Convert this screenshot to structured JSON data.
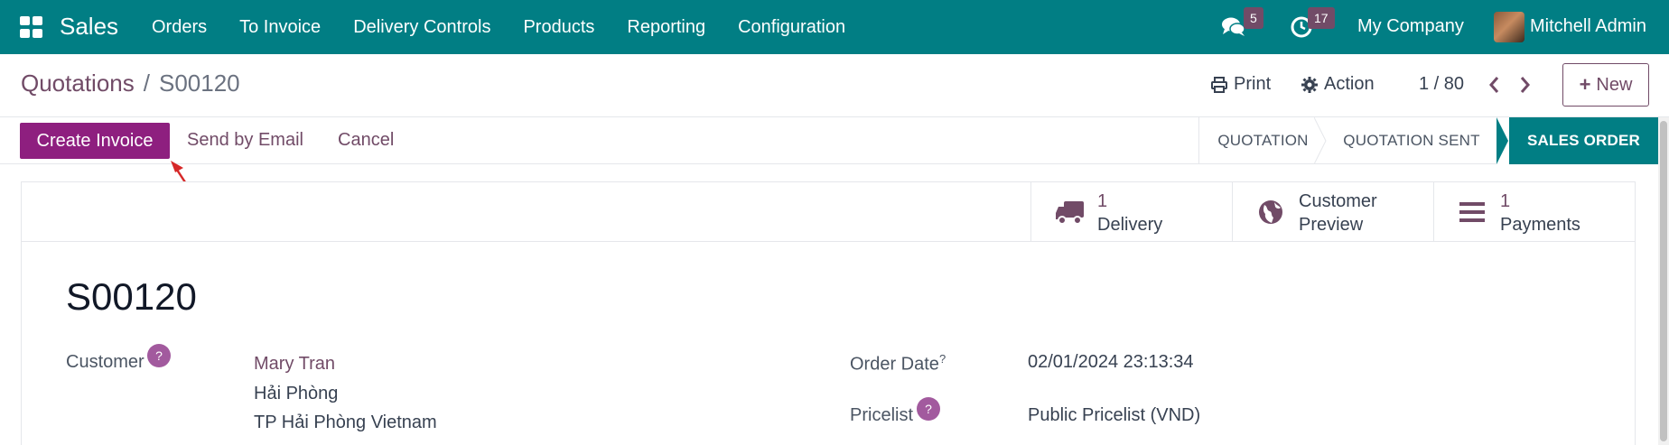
{
  "navbar": {
    "app_name": "Sales",
    "menu": [
      "Orders",
      "To Invoice",
      "Delivery Controls",
      "Products",
      "Reporting",
      "Configuration"
    ],
    "messages_icon": "chat-icon",
    "messages_count": "5",
    "activities_icon": "clock-icon",
    "activities_count": "17",
    "company": "My Company",
    "user": "Mitchell Admin"
  },
  "breadcrumb": {
    "parent": "Quotations",
    "separator": "/",
    "current": "S00120"
  },
  "toolbar": {
    "print_label": "Print",
    "action_label": "Action",
    "pager": "1 / 80",
    "new_label": "New"
  },
  "actions": {
    "create_invoice": "Create Invoice",
    "send_by_email": "Send by Email",
    "cancel": "Cancel"
  },
  "stages": [
    "QUOTATION",
    "QUOTATION SENT",
    "SALES ORDER"
  ],
  "active_stage": "SALES ORDER",
  "smart_buttons": [
    {
      "value": "1",
      "label": "Delivery",
      "icon": "truck-icon"
    },
    {
      "value": "Customer",
      "label": "Preview",
      "icon": "globe-icon"
    },
    {
      "value": "1",
      "label": "Payments",
      "icon": "list-icon"
    }
  ],
  "form": {
    "name": "S00120",
    "customer_label": "Customer",
    "customer_help": "?",
    "customer_name": "Mary Tran",
    "customer_address_line1": "Hải Phòng",
    "customer_address_line2": "TP Hải Phòng Vietnam",
    "order_date_label": "Order Date",
    "order_date_help": "?",
    "order_date": "02/01/2024 23:13:34",
    "pricelist_label": "Pricelist",
    "pricelist_help": "?",
    "pricelist": "Public Pricelist (VND)"
  },
  "colors": {
    "navbar": "#017e84",
    "primary": "#714b67",
    "create_invoice_button": "#8e1f7f",
    "active_stage": "#017e84",
    "annotation_arrow": "#d62828"
  }
}
